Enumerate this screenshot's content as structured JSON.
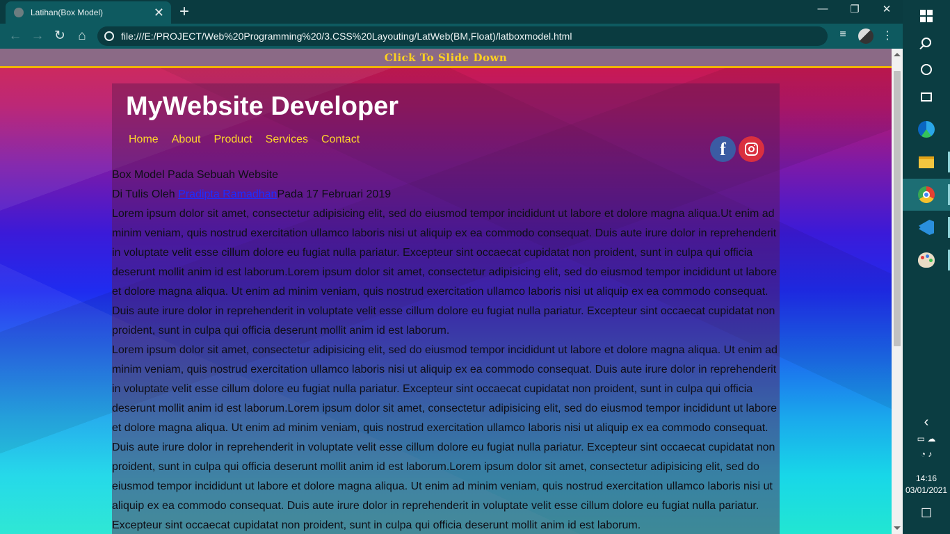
{
  "browser": {
    "tab_title": "Latihan(Box Model)",
    "tab_close": "✕",
    "new_tab": "+",
    "window_controls": {
      "minimize": "—",
      "restore": "❐",
      "close": "✕"
    },
    "nav": {
      "back": "←",
      "forward": "→",
      "reload": "↻",
      "home": "⌂"
    },
    "url": "file:///E:/PROJECT/Web%20Programming%20/3.CSS%20Layouting/LatWeb(BM,Float)/latboxmodel.html",
    "toolbar_icons": {
      "media": "≡",
      "menu": "⋮"
    }
  },
  "page": {
    "slide_bar": "Click To Slide Down",
    "brand": "MyWebsite Developer",
    "menu": [
      "Home",
      "About",
      "Product",
      "Services",
      "Contact"
    ],
    "social": {
      "facebook": "f"
    },
    "article_title": "Box Model Pada Sebuah Website",
    "byline_prefix": "Di Tulis Oleh ",
    "author": "Pradipta Ramadhan",
    "byline_suffix": "Pada 17 Februari 2019",
    "paragraph1": "Lorem ipsum dolor sit amet, consectetur adipisicing elit, sed do eiusmod tempor incididunt ut labore et dolore magna aliqua.Ut enim ad minim veniam, quis nostrud exercitation ullamco laboris nisi ut aliquip ex ea commodo consequat. Duis aute irure dolor in reprehenderit in voluptate velit esse cillum dolore eu fugiat nulla pariatur. Excepteur sint occaecat cupidatat non proident, sunt in culpa qui officia deserunt mollit anim id est laborum.Lorem ipsum dolor sit amet, consectetur adipisicing elit, sed do eiusmod tempor incididunt ut labore et dolore magna aliqua. Ut enim ad minim veniam, quis nostrud exercitation ullamco laboris nisi ut aliquip ex ea commodo consequat. Duis aute irure dolor in reprehenderit in voluptate velit esse cillum dolore eu fugiat nulla pariatur. Excepteur sint occaecat cupidatat non proident, sunt in culpa qui officia deserunt mollit anim id est laborum.",
    "paragraph2": "Lorem ipsum dolor sit amet, consectetur adipisicing elit, sed do eiusmod tempor incididunt ut labore et dolore magna aliqua. Ut enim ad minim veniam, quis nostrud exercitation ullamco laboris nisi ut aliquip ex ea commodo consequat. Duis aute irure dolor in reprehenderit in voluptate velit esse cillum dolore eu fugiat nulla pariatur. Excepteur sint occaecat cupidatat non proident, sunt in culpa qui officia deserunt mollit anim id est laborum.Lorem ipsum dolor sit amet, consectetur adipisicing elit, sed do eiusmod tempor incididunt ut labore et dolore magna aliqua. Ut enim ad minim veniam, quis nostrud exercitation ullamco laboris nisi ut aliquip ex ea commodo consequat. Duis aute irure dolor in reprehenderit in voluptate velit esse cillum dolore eu fugiat nulla pariatur. Excepteur sint occaecat cupidatat non proident, sunt in culpa qui officia deserunt mollit anim id est laborum.Lorem ipsum dolor sit amet, consectetur adipisicing elit, sed do eiusmod tempor incididunt ut labore et dolore magna aliqua. Ut enim ad minim veniam, quis nostrud exercitation ullamco laboris nisi ut aliquip ex ea commodo consequat. Duis aute irure dolor in reprehenderit in voluptate velit esse cillum dolore eu fugiat nulla pariatur. Excepteur sint occaecat cupidatat non proident, sunt in culpa qui officia deserunt mollit anim id est laborum."
  },
  "taskbar": {
    "chevron": "‹",
    "time": "14:16",
    "date": "03/01/2021",
    "notifications": "☐"
  },
  "colors": {
    "slide_bar_text": "#ffd21f",
    "menu_link": "#ffd72a",
    "author_link": "#1e2cff",
    "facebook": "#3b5ba3",
    "instagram": "#d9303f"
  }
}
